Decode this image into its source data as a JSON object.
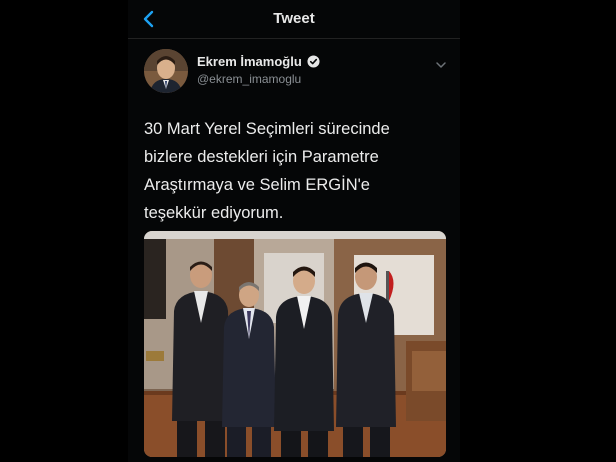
{
  "header": {
    "title": "Tweet"
  },
  "author": {
    "display_name": "Ekrem İmamoğlu",
    "handle": "@ekrem_imamoglu"
  },
  "tweet": {
    "lines": [
      "30 Mart Yerel Seçimleri sürecinde",
      "bizlere destekleri için Parametre",
      "Araştırmaya ve Selim ERGİN'e",
      "teşekkür ediyorum."
    ]
  },
  "colors": {
    "accent": "#1da1f2",
    "background": "#000000",
    "secondary_text": "#8a8f94"
  },
  "icons": [
    "back-arrow-icon",
    "verified-badge-icon",
    "chevron-down-icon"
  ]
}
